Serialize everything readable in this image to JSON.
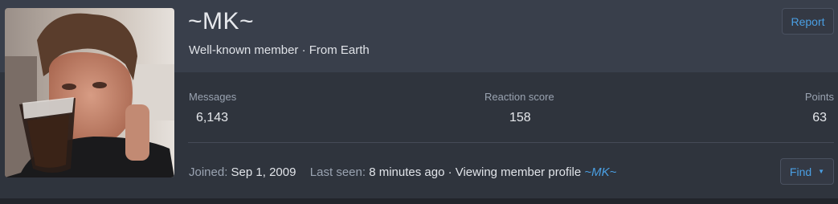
{
  "profile": {
    "username": "~MK~",
    "subtitle": "Well-known member · From Earth"
  },
  "actions": {
    "report_label": "Report",
    "find_label": "Find",
    "find_caret": "▼"
  },
  "stats": {
    "messages": {
      "label": "Messages",
      "value": "6,143"
    },
    "reaction_score": {
      "label": "Reaction score",
      "value": "158"
    },
    "points": {
      "label": "Points",
      "value": "63"
    }
  },
  "footer": {
    "joined_label": "Joined:",
    "joined_value": "Sep 1, 2009",
    "last_seen_label": "Last seen:",
    "last_seen_value": "8 minutes ago · Viewing member profile",
    "last_seen_link": "~MK~"
  },
  "colors": {
    "accent": "#4a9fe3",
    "card_bg": "#393f4b",
    "panel_bg": "#2f343d"
  }
}
